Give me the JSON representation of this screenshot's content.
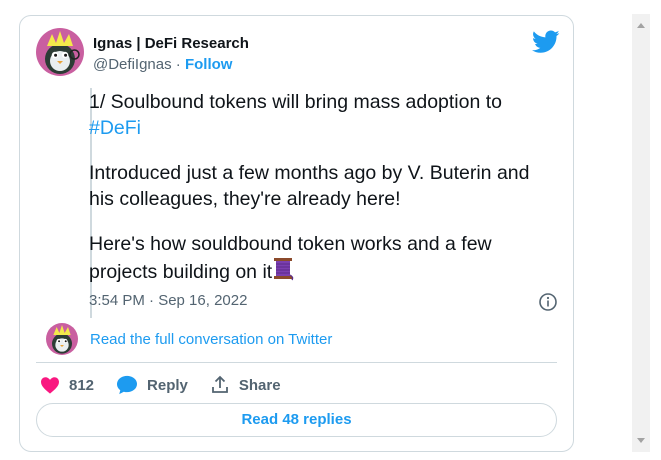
{
  "tweet": {
    "author_name": "Ignas | DeFi Research",
    "handle": "@DefiIgnas",
    "separator": " · ",
    "follow_label": "Follow",
    "text_line1": "1/ Soulbound tokens will bring mass adoption to",
    "hashtag": "#DeFi",
    "paragraph2": "Introduced just a few months ago by V. Buterin and his colleagues, they're already here!",
    "paragraph3": "Here's how souldbound token works and a few projects building on it",
    "emoji_name": "thread-spool",
    "timestamp": "3:54 PM · Sep 16, 2022"
  },
  "conversation": {
    "read_full_label": "Read the full conversation on Twitter"
  },
  "actions": {
    "likes_count": "812",
    "reply_label": "Reply",
    "share_label": "Share",
    "read_replies_label": "Read 48 replies"
  },
  "colors": {
    "accent": "#1d9bf0",
    "like": "#f91880",
    "text": "#0f1419",
    "muted": "#536471",
    "border": "#cfd9de"
  },
  "icons": [
    "twitter-bird-icon",
    "info-icon",
    "heart-icon",
    "reply-bubble-icon",
    "share-icon",
    "thread-spool-emoji",
    "scroll-up-arrow",
    "scroll-down-arrow"
  ]
}
